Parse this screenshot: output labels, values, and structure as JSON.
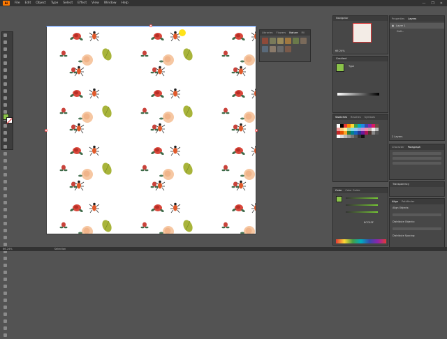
{
  "app": {
    "logo_text": "Ai"
  },
  "menu": [
    "File",
    "Edit",
    "Object",
    "Type",
    "Select",
    "Effect",
    "View",
    "Window",
    "Help"
  ],
  "window_controls": {
    "minimize": "—",
    "maximize": "❐",
    "close": "✕"
  },
  "swatch_float": {
    "tabs": [
      "Libraries",
      "Flowers",
      "Nature",
      "Fill"
    ],
    "active_tab": "Nature"
  },
  "navigator": {
    "title": "Navigator",
    "zoom": "66.24%"
  },
  "gradient": {
    "title": "Gradient",
    "type_label": "Type"
  },
  "swatches": {
    "tabs": [
      "Swatches",
      "Brushes",
      "Symbols"
    ]
  },
  "color": {
    "tabs": [
      "Color",
      "Color Guide"
    ],
    "hex": "8CC63F"
  },
  "properties": {
    "tabs": [
      "Properties",
      "Layers"
    ],
    "layers": [
      {
        "name": "Layer 1"
      },
      {
        "name": "Coll..."
      }
    ],
    "count": "2 Layers"
  },
  "character": {
    "tabs": [
      "Character",
      "Paragraph"
    ]
  },
  "transparency": {
    "title": "Transparency"
  },
  "align": {
    "tabs": [
      "Align",
      "Pathfinder"
    ],
    "labels": [
      "Align Objects:",
      "Distribute Objects:",
      "Distribute Spacing:"
    ]
  },
  "status": {
    "zoom": "66.24%",
    "tool": "Selection"
  },
  "colors": {
    "fill": "#8bc34a",
    "accent": "#ff7c00"
  }
}
